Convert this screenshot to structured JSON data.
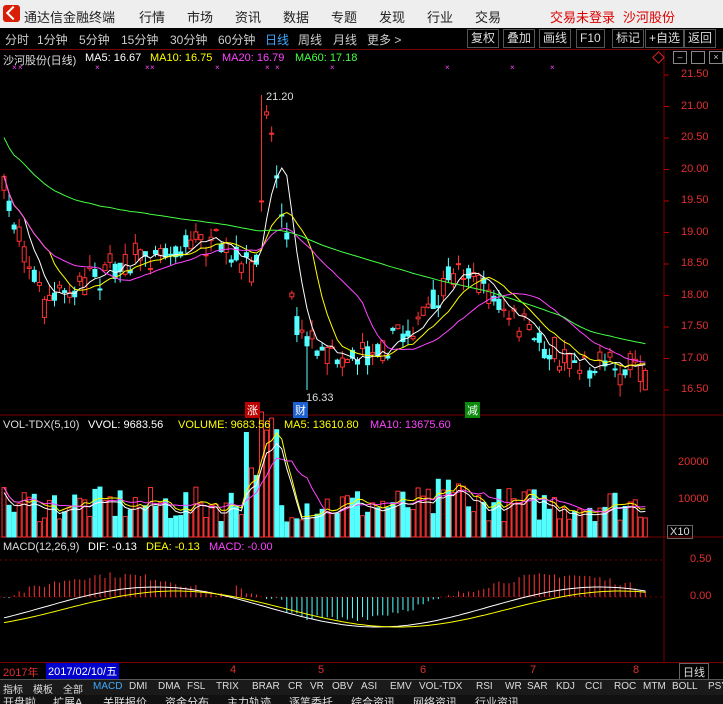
{
  "app": {
    "title": "通达信金融终端",
    "login_status": "交易未登录",
    "stock_name": "沙河股份"
  },
  "menu": [
    "行情",
    "市场",
    "资讯",
    "数据",
    "专题",
    "发现",
    "行业",
    "交易"
  ],
  "periods": [
    "分时",
    "1分钟",
    "5分钟",
    "15分钟",
    "30分钟",
    "60分钟",
    "日线",
    "周线",
    "月线",
    "更多 >"
  ],
  "active_period": "日线",
  "tools": [
    "复权",
    "叠加",
    "画线",
    "F10",
    "标记",
    "+自选",
    "返回"
  ],
  "main_chart": {
    "title": "沙河股份(日线)",
    "ma5": "MA5: 16.67",
    "ma10": "MA10: 16.75",
    "ma20": "MA20: 16.79",
    "ma60": "MA60: 17.18",
    "high_label": "21.20",
    "low_label": "16.33",
    "markers": [
      "涨",
      "财",
      "减"
    ],
    "y_axis": [
      "21.50",
      "21.00",
      "20.50",
      "20.00",
      "19.50",
      "19.00",
      "18.50",
      "18.00",
      "17.50",
      "17.00",
      "16.50"
    ]
  },
  "volume_panel": {
    "title": "VOL-TDX(5,10)",
    "vvol": "VVOL: 9683.56",
    "volume": "VOLUME: 9683.56",
    "ma5": "MA5: 13610.80",
    "ma10": "MA10: 13675.60",
    "y_axis": [
      "20000",
      "10000"
    ],
    "unit": "X10"
  },
  "macd_panel": {
    "title": "MACD(12,26,9)",
    "dif": "DIF: -0.13",
    "dea": "DEA: -0.13",
    "macd": "MACD: -0.00",
    "y_axis": [
      "0.50",
      "0.00"
    ]
  },
  "date_axis": {
    "year": "2017年",
    "cursor_date": "2017/02/10/五",
    "months": [
      "4",
      "5",
      "6",
      "7",
      "8"
    ],
    "view": "日线"
  },
  "indicators": [
    "指标",
    "模板",
    "全部",
    "MACD",
    "DMI",
    "DMA",
    "FSL",
    "TRIX",
    "BRAR",
    "CR",
    "VR",
    "OBV",
    "ASI",
    "EMV",
    "VOL-TDX",
    "RSI",
    "WR",
    "SAR",
    "KDJ",
    "CCI",
    "ROC",
    "MTM",
    "BOLL",
    "PSY"
  ],
  "bottom_tabs": [
    "开盘啦",
    "扩展A",
    "关联报价",
    "资金分布",
    "主力轨迹",
    "逐笔委托",
    "综合资讯",
    "网络资讯",
    "行业资讯"
  ],
  "colors": {
    "up": "#ff3232",
    "down": "#54ffff",
    "ma5": "#ffffff",
    "ma10": "#ffff00",
    "ma20": "#ff44ff",
    "ma60": "#44ff44"
  }
}
